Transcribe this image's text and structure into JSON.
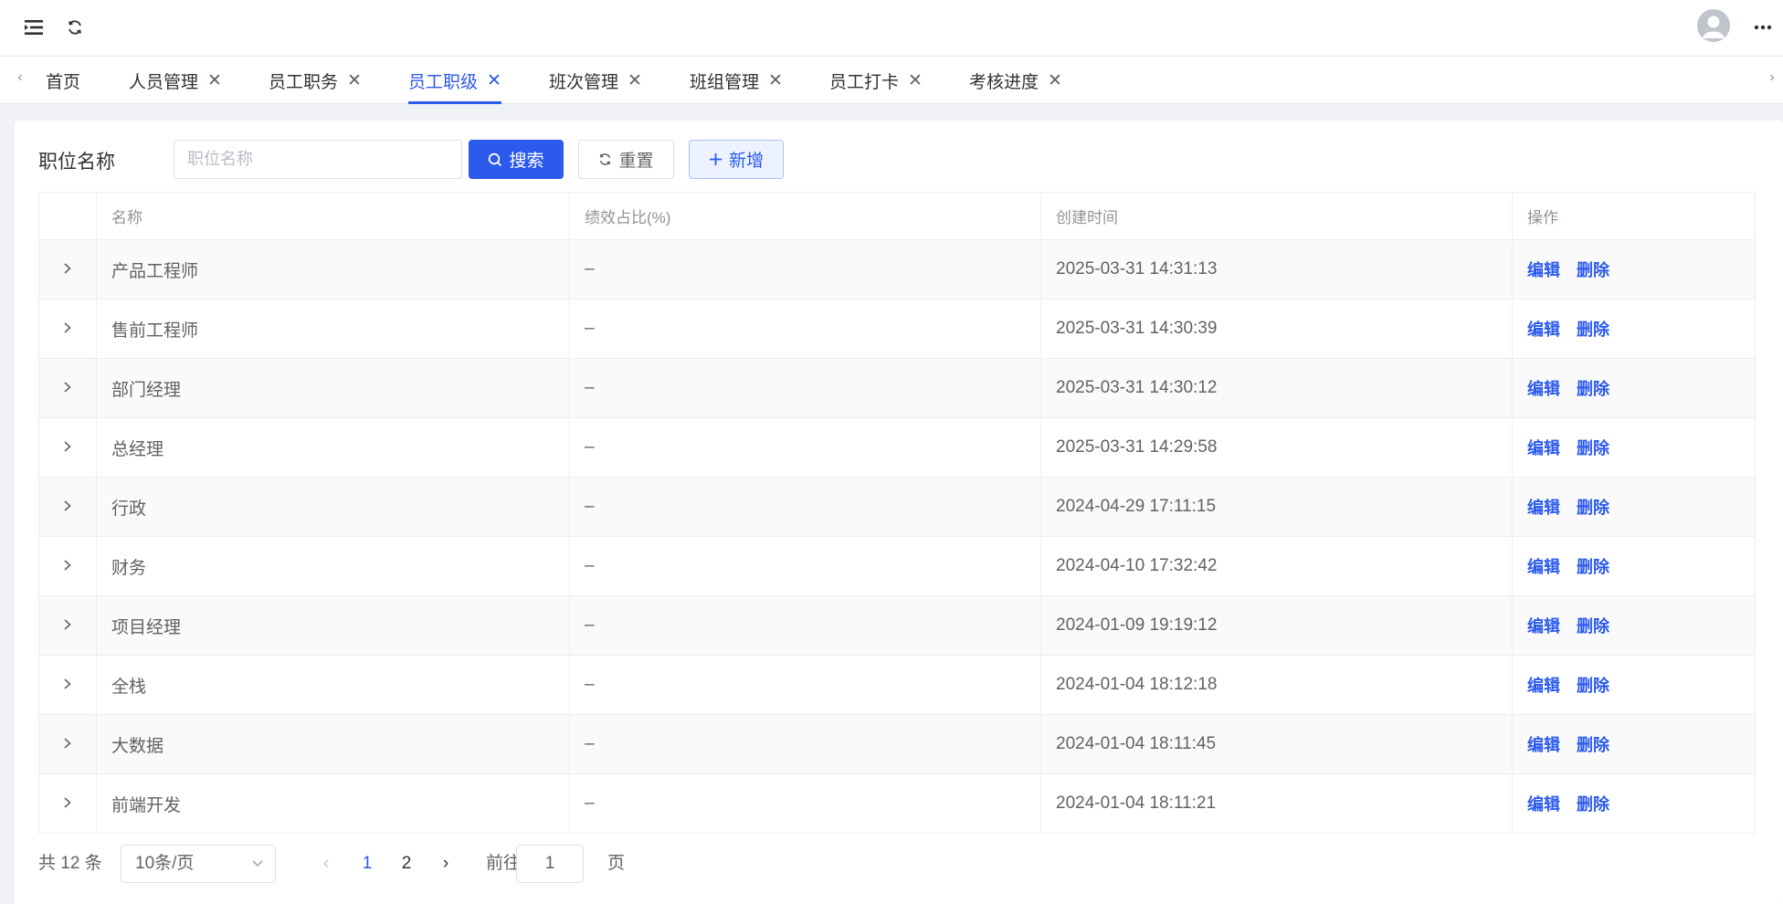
{
  "header": {
    "menu_icon": "hamburger-menu-icon",
    "refresh_icon": "refresh-icon",
    "more_icon": "more-dots-icon"
  },
  "tabs": [
    {
      "label": "首页",
      "closable": false,
      "active": false
    },
    {
      "label": "人员管理",
      "closable": true,
      "active": false
    },
    {
      "label": "员工职务",
      "closable": true,
      "active": false
    },
    {
      "label": "员工职级",
      "closable": true,
      "active": true
    },
    {
      "label": "班次管理",
      "closable": true,
      "active": false
    },
    {
      "label": "班组管理",
      "closable": true,
      "active": false
    },
    {
      "label": "员工打卡",
      "closable": true,
      "active": false
    },
    {
      "label": "考核进度",
      "closable": true,
      "active": false
    }
  ],
  "filter": {
    "label": "职位名称",
    "input_value": "",
    "input_placeholder": "职位名称",
    "search_label": "搜索",
    "reset_label": "重置",
    "add_label": "新增"
  },
  "table": {
    "columns": [
      "名称",
      "绩效占比(%)",
      "创建时间",
      "操作"
    ],
    "rows": [
      {
        "name": "产品工程师",
        "ratio": "–",
        "created": "2025-03-31 14:31:13"
      },
      {
        "name": "售前工程师",
        "ratio": "–",
        "created": "2025-03-31 14:30:39"
      },
      {
        "name": "部门经理",
        "ratio": "–",
        "created": "2025-03-31 14:30:12"
      },
      {
        "name": "总经理",
        "ratio": "–",
        "created": "2025-03-31 14:29:58"
      },
      {
        "name": "行政",
        "ratio": "–",
        "created": "2024-04-29 17:11:15"
      },
      {
        "name": "财务",
        "ratio": "–",
        "created": "2024-04-10 17:32:42"
      },
      {
        "name": "项目经理",
        "ratio": "–",
        "created": "2024-01-09 19:19:12"
      },
      {
        "name": "全栈",
        "ratio": "–",
        "created": "2024-01-04 18:12:18"
      },
      {
        "name": "大数据",
        "ratio": "–",
        "created": "2024-01-04 18:11:45"
      },
      {
        "name": "前端开发",
        "ratio": "–",
        "created": "2024-01-04 18:11:21"
      }
    ],
    "edit_label": "编辑",
    "delete_label": "删除"
  },
  "pagination": {
    "total_text": "共 12 条",
    "page_size": "10条/页",
    "pages": [
      "1",
      "2"
    ],
    "current_page": "1",
    "goto_prefix": "前往",
    "goto_value": "1",
    "goto_suffix": "页"
  },
  "colors": {
    "primary": "#2b5aed",
    "text": "#303133",
    "muted": "#909399",
    "border": "#ebeef5"
  }
}
